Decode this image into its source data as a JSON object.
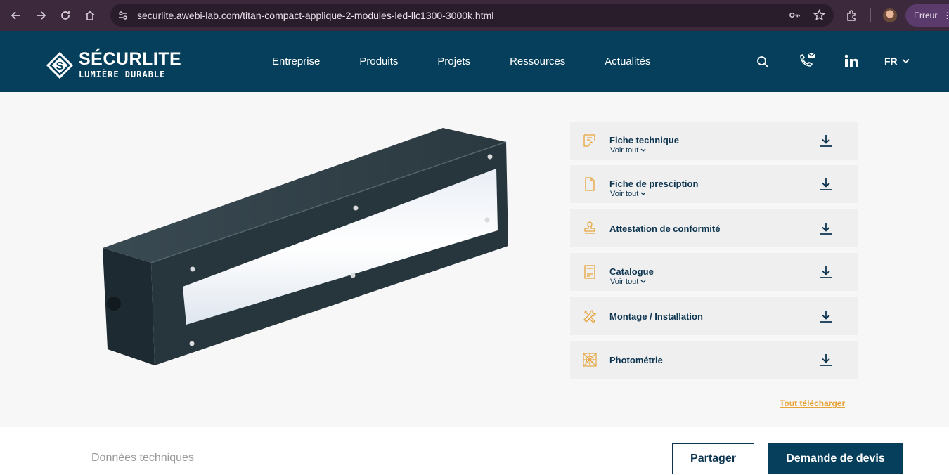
{
  "browser": {
    "url": "securlite.awebi-lab.com/titan-compact-applique-2-modules-led-llc1300-3000k.html",
    "profile_status": "Erreur",
    "icons": [
      "back-icon",
      "forward-icon",
      "reload-icon",
      "home-icon",
      "site-info-icon",
      "key-icon",
      "star-icon",
      "extensions-icon",
      "menu-icon"
    ]
  },
  "header": {
    "logo_name": "SÉCURLITE",
    "logo_tagline": "LUMIÈRE DURABLE",
    "nav": [
      "Entreprise",
      "Produits",
      "Projets",
      "Ressources",
      "Actualités"
    ],
    "language": "FR",
    "icons": [
      "search-icon",
      "phone-mail-icon",
      "linkedin-icon",
      "chevron-down-icon"
    ],
    "colors": {
      "background": "#053f5c"
    }
  },
  "downloads": {
    "items": [
      {
        "title": "Fiche technique",
        "sub": "Voir tout",
        "icon": "tech-sheet-icon"
      },
      {
        "title": "Fiche de presciption",
        "sub": "Voir tout",
        "icon": "document-icon"
      },
      {
        "title": "Attestation de conformité",
        "icon": "stamp-icon"
      },
      {
        "title": "Catalogue",
        "sub": "Voir tout",
        "icon": "catalogue-icon"
      },
      {
        "title": "Montage / Installation",
        "icon": "tools-icon"
      },
      {
        "title": "Photométrie",
        "icon": "photometry-icon"
      }
    ],
    "download_all": "Tout télécharger",
    "colors": {
      "accent": "#e6a33a",
      "text": "#0d3550",
      "row_bg": "#efefef"
    }
  },
  "bottom": {
    "tech_data": "Données techniques",
    "share": "Partager",
    "quote": "Demande de devis"
  }
}
